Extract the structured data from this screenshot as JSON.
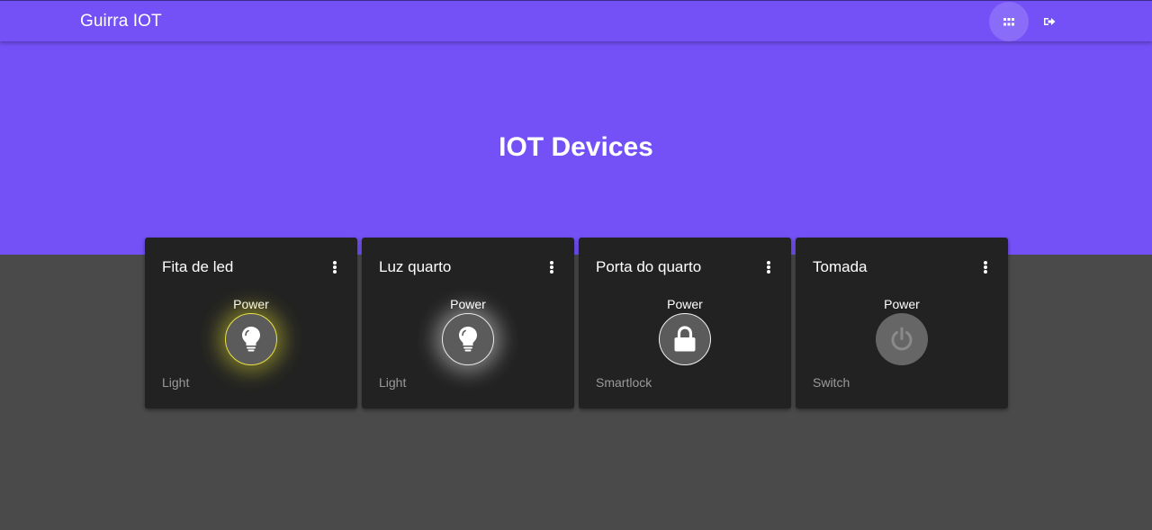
{
  "appbar": {
    "title": "Guirra IOT",
    "apps_icon": "apps-grid-icon",
    "logout_icon": "logout-icon"
  },
  "hero": {
    "title": "IOT Devices"
  },
  "devices": [
    {
      "name": "Fita de led",
      "power_label": "Power",
      "type": "Light",
      "icon": "lightbulb-icon",
      "state": "on",
      "glow_color": "#e8e046"
    },
    {
      "name": "Luz quarto",
      "power_label": "Power",
      "type": "Light",
      "icon": "lightbulb-icon",
      "state": "on",
      "glow_color": "#ffffff"
    },
    {
      "name": "Porta do quarto",
      "power_label": "Power",
      "type": "Smartlock",
      "icon": "lock-icon",
      "state": "locked"
    },
    {
      "name": "Tomada",
      "power_label": "Power",
      "type": "Switch",
      "icon": "power-icon",
      "state": "off"
    }
  ],
  "colors": {
    "primary": "#7351f7",
    "card_background": "#222222",
    "page_background": "#4a4a4a"
  }
}
